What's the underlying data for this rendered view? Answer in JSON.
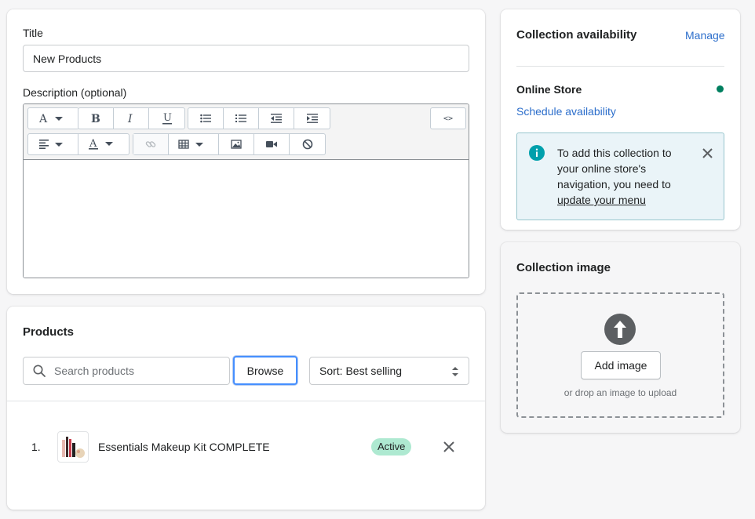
{
  "title_section": {
    "title_label": "Title",
    "title_value": "New Products",
    "description_label": "Description (optional)",
    "editor_icons": [
      "font-icon",
      "bold-icon",
      "italic-icon",
      "underline-icon",
      "bulleted-list-icon",
      "numbered-list-icon",
      "outdent-icon",
      "indent-icon",
      "code-view-icon",
      "align-icon",
      "text-color-icon",
      "link-icon",
      "table-icon",
      "image-icon",
      "video-icon",
      "clear-format-icon"
    ],
    "code_view_label": "<>"
  },
  "products": {
    "heading": "Products",
    "search_placeholder": "Search products",
    "browse_label": "Browse",
    "sort_label": "Sort: Best selling",
    "items": [
      {
        "index": "1.",
        "name": "Essentials Makeup Kit COMPLETE",
        "status": "Active"
      }
    ]
  },
  "availability": {
    "heading": "Collection availability",
    "manage_label": "Manage",
    "channel_name": "Online Store",
    "channel_status_color": "#007f5f",
    "schedule_label": "Schedule availability",
    "banner_text_lines": [
      "To add this collection to",
      "your online store's",
      "navigation, you need to"
    ],
    "banner_link": "update your menu"
  },
  "image_section": {
    "heading": "Collection image",
    "add_image_label": "Add image",
    "drop_hint": "or drop an image to upload"
  },
  "colors": {
    "accent": "#2c6ecb",
    "active_badge_bg": "#aee9d1",
    "banner_bg": "#eaf4f8",
    "banner_border": "#98c6cd",
    "info_icon": "#00a0ac"
  }
}
